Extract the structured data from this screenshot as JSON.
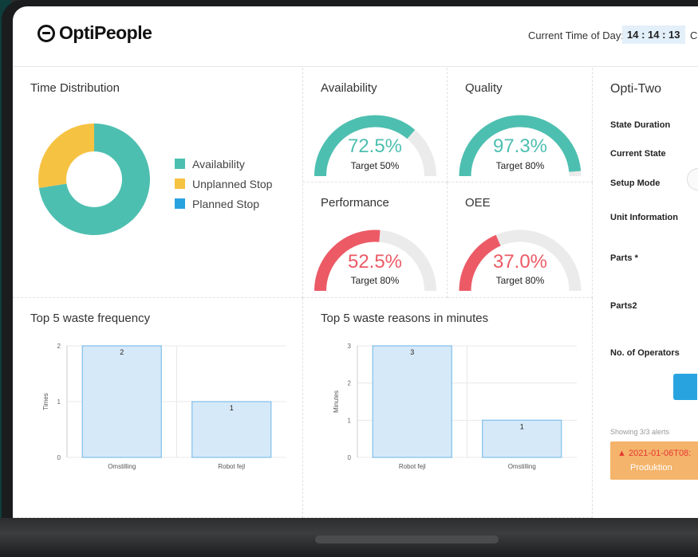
{
  "header": {
    "logo_text": "OptiPeople",
    "time_label": "Current Time of Day:",
    "time_value": "14 : 14 : 13",
    "time_extra": "C"
  },
  "time_distribution": {
    "title": "Time Distribution",
    "legend": [
      {
        "label": "Availability",
        "color": "#4dbfb0"
      },
      {
        "label": "Unplanned Stop",
        "color": "#f6c242"
      },
      {
        "label": "Planned Stop",
        "color": "#29a3e0"
      }
    ]
  },
  "gauges": [
    {
      "title": "Availability",
      "value": "72.5%",
      "target": "Target 50%",
      "fraction": 0.725,
      "color": "#4dbfb0"
    },
    {
      "title": "Quality",
      "value": "97.3%",
      "target": "Target 80%",
      "fraction": 0.973,
      "color": "#4dbfb0"
    },
    {
      "title": "Performance",
      "value": "52.5%",
      "target": "Target 80%",
      "fraction": 0.525,
      "color": "#ec5a66"
    },
    {
      "title": "OEE",
      "value": "37.0%",
      "target": "Target 80%",
      "fraction": 0.37,
      "color": "#ec5a66"
    }
  ],
  "chart_data": [
    {
      "type": "pie",
      "title": "Time Distribution",
      "categories": [
        "Availability",
        "Unplanned Stop",
        "Planned Stop"
      ],
      "values": [
        72.5,
        27.5,
        0
      ],
      "colors": [
        "#4dbfb0",
        "#f6c242",
        "#29a3e0"
      ]
    },
    {
      "type": "bar",
      "title": "Top 5 waste frequency",
      "categories": [
        "Omstilling",
        "Robot fejl"
      ],
      "values": [
        2,
        1
      ],
      "ylabel": "Times",
      "yticks": [
        0,
        1,
        2
      ],
      "ylim": [
        0,
        2
      ]
    },
    {
      "type": "bar",
      "title": "Top 5 waste reasons in minutes",
      "categories": [
        "Robot fejl",
        "Omstilling"
      ],
      "values": [
        3,
        1
      ],
      "ylabel": "Minutes",
      "yticks": [
        0,
        1,
        2,
        3
      ],
      "ylim": [
        0,
        3
      ]
    }
  ],
  "side": {
    "title": "Opti-Two",
    "labels": [
      "State Duration",
      "Current State",
      "Setup Mode",
      "Unit Information",
      "Parts *",
      "Parts2",
      "No. of Operators"
    ],
    "alerts_text": "Showing 3/3 alerts",
    "alert_line1": "2021-01-06T08:",
    "alert_line2": "Produktion"
  }
}
